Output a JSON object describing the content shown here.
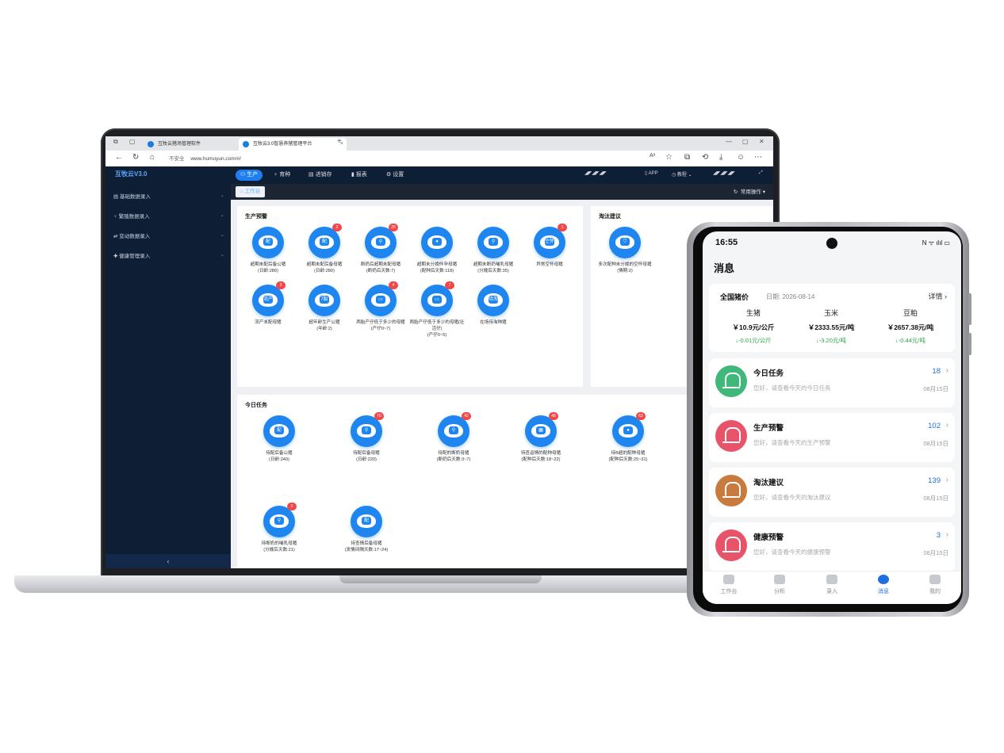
{
  "browser": {
    "tabs": [
      "互牧云猪场管理软件",
      "互牧云3.0智慧养猪管理平台"
    ],
    "address_insecure": "不安全",
    "address_url": "www.humuyun.com/#/"
  },
  "app": {
    "logo": "互牧云V3.0",
    "sidebar": [
      {
        "label": "基础数据录入"
      },
      {
        "label": "繁殖数据录入"
      },
      {
        "label": "变动数据录入"
      },
      {
        "label": "健康管理录入"
      }
    ],
    "collapse": "‹",
    "nav": [
      {
        "label": "生产",
        "active": true
      },
      {
        "label": "育种"
      },
      {
        "label": "进销存"
      },
      {
        "label": "报表"
      },
      {
        "label": "设置"
      }
    ],
    "nav_right": {
      "app": "APP",
      "tutorial": "教程"
    },
    "workbench_tab": "工作台",
    "common_ops": "常用操作",
    "production_warning": {
      "title": "生产预警",
      "items": [
        {
          "glyph": "配",
          "label": "超期未配后备公猪",
          "sub": "(日龄:280)",
          "badge": ""
        },
        {
          "glyph": "配",
          "label": "超期未配后备母猪",
          "sub": "(日龄:280)",
          "badge": "2"
        },
        {
          "glyph": "⚲",
          "label": "断奶后超期未配母猪",
          "sub": "(断奶后天数:7)",
          "badge": "26"
        },
        {
          "glyph": "●",
          "label": "超期未分娩怀孕母猪",
          "sub": "(配种后天数:118)",
          "badge": ""
        },
        {
          "glyph": "⚲",
          "label": "超期未断奶哺乳母猪",
          "sub": "(分娩后天数:35)",
          "badge": ""
        },
        {
          "glyph": "空怀",
          "label": "异常空怀母猪",
          "sub": "",
          "badge": "1"
        },
        {
          "glyph": "流产",
          "label": "流产未配母猪",
          "sub": "",
          "badge": "3"
        },
        {
          "glyph": "7胎",
          "label": "超年龄生产公猪",
          "sub": "(年龄:2)",
          "badge": ""
        },
        {
          "glyph": "▭",
          "label": "两胎产仔低于多少的母猪",
          "sub": "(产仔0~7)",
          "badge": "4"
        },
        {
          "glyph": "▭",
          "label": "两胎产仔低于多少的母猪(壮活仔)",
          "sub": "(产仔0~5)",
          "badge": "7"
        },
        {
          "glyph": "待淘",
          "label": "在场待淘种猪",
          "sub": "",
          "badge": ""
        }
      ]
    },
    "culling": {
      "title": "淘汰建议",
      "items": [
        {
          "glyph": "⛉",
          "label": "多次配种未分娩的空怀母猪",
          "sub": "(情期:2)",
          "badge": ""
        }
      ]
    },
    "today_tasks": {
      "title": "今日任务",
      "items": [
        {
          "glyph": "配",
          "label": "待配后备公猪",
          "sub": "(日龄:240)",
          "badge": ""
        },
        {
          "glyph": "⚲",
          "label": "待配后备母猪",
          "sub": "(日龄:220)",
          "badge": "70"
        },
        {
          "glyph": "⚲",
          "label": "待配的断奶母猪",
          "sub": "(断奶后天数:3~7)",
          "badge": "42"
        },
        {
          "glyph": "▦",
          "label": "待查返情的配种母猪",
          "sub": "(配种后天数:18~22)",
          "badge": "48"
        },
        {
          "glyph": "●",
          "label": "待B超的配种母猪",
          "sub": "(配种后天数:25~31)",
          "badge": "63"
        },
        {
          "glyph": "⚲",
          "label": "待断奶的哺乳母猪",
          "sub": "(分娩后天数:21)",
          "badge": "2"
        },
        {
          "glyph": "配",
          "label": "待查情后备母猪",
          "sub": "(发情间隔天数:17~24)",
          "badge": ""
        }
      ]
    }
  },
  "phone": {
    "time": "16:55",
    "status_icons": "N ᯤ ılıl ▭",
    "title": "消息",
    "price": {
      "heading": "全国猪价",
      "date": "日期: 2026-08-14",
      "detail": "详情",
      "cols": [
        {
          "name": "生猪",
          "value": "￥10.9元/公斤",
          "change": "↓-0.01元/公斤"
        },
        {
          "name": "玉米",
          "value": "￥2333.55元/吨",
          "change": "↓-3.20元/吨"
        },
        {
          "name": "豆粕",
          "value": "￥2657.38元/吨",
          "change": "↓-0.44元/吨"
        }
      ]
    },
    "messages": [
      {
        "name": "今日任务",
        "desc": "您好，请查看今天的今日任务",
        "count": "18",
        "date": "08月15日",
        "color": "#3fb87a"
      },
      {
        "name": "生产预警",
        "desc": "您好，请查看今天的生产预警",
        "count": "102",
        "date": "08月15日",
        "color": "#e8536a"
      },
      {
        "name": "淘汰建议",
        "desc": "您好，请查看今天的淘汰建议",
        "count": "139",
        "date": "08月15日",
        "color": "#c97a3d"
      },
      {
        "name": "健康预警",
        "desc": "您好，请查看今天的健康预警",
        "count": "3",
        "date": "08月15日",
        "color": "#e8536a"
      }
    ],
    "tabs": [
      {
        "label": "工作台"
      },
      {
        "label": "分析"
      },
      {
        "label": "录入"
      },
      {
        "label": "消息",
        "active": true
      },
      {
        "label": "我的"
      }
    ]
  },
  "colors": {
    "accent": "#1f86f0",
    "sidebar": "#0e1e35",
    "badge": "#f04848"
  }
}
